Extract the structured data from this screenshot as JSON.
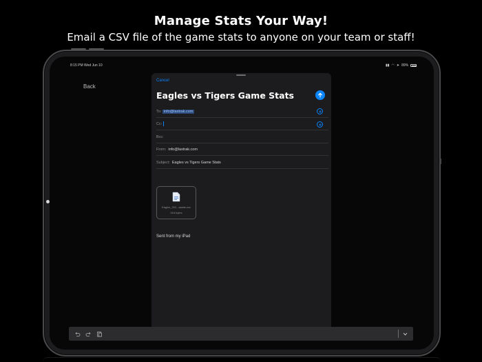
{
  "promo": {
    "headline": "Manage Stats Your Way!",
    "subheadline": "Email a CSV file of the game stats to anyone on your team or staff!"
  },
  "status_bar": {
    "time_date": "8:15 PM   Wed Jun 10",
    "battery_text": "89%"
  },
  "nav": {
    "back_label": "Back"
  },
  "compose": {
    "cancel_label": "Cancel",
    "subject_title": "Eagles vs Tigers Game Stats",
    "to_label": "To:",
    "to_value": "info@laxtrak.com",
    "cc_label": "Cc:",
    "bcc_label": "Bcc:",
    "from_label": "From:",
    "from_value": "info@laxtrak.com",
    "subject_label": "Subject:",
    "subject_value": "Eagles vs Tigers Game Stats",
    "attachment_name": "Eagles_202...sstats.csv",
    "attachment_size": "918 bytes",
    "signature": "Sent from my iPad"
  },
  "colors": {
    "accent": "#0a84ff",
    "sheet_bg": "#1c1c1e",
    "toolbar_bg": "#2c2c2e"
  }
}
